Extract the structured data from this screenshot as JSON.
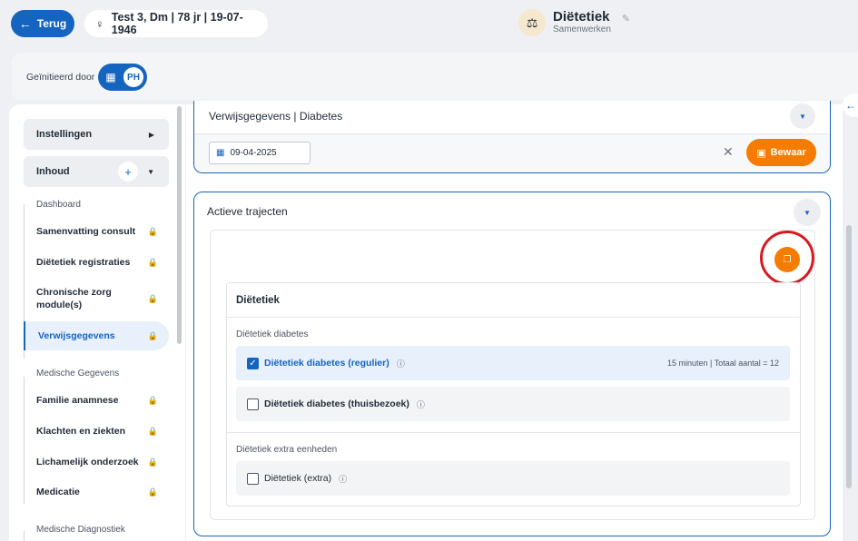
{
  "header": {
    "back_label": "Terug",
    "patient": "Test 3, Dm | 78 jr | 19-07-1946",
    "gender_icon": "female-icon",
    "module_title": "Diëtetiek",
    "module_subtitle": "Samenwerken"
  },
  "initiated": {
    "label": "Geïnitieerd door",
    "initials": "PH"
  },
  "sidebar": {
    "settings_label": "Instellingen",
    "content_label": "Inhoud",
    "plus": "+",
    "groups": {
      "dashboard": "Dashboard",
      "medical": "Medische Gegevens",
      "diagnostics": "Medische Diagnostiek"
    },
    "items": [
      {
        "label": "Samenvatting consult"
      },
      {
        "label": "Diëtetiek registraties"
      },
      {
        "label": "Chronische zorg module(s)"
      },
      {
        "label": "Verwijsgegevens",
        "active": true
      },
      {
        "label": "Familie anamnese"
      },
      {
        "label": "Klachten en ziekten"
      },
      {
        "label": "Lichamelijk onderzoek"
      },
      {
        "label": "Medicatie"
      }
    ]
  },
  "referral": {
    "title": "Verwijsgegevens | Diabetes",
    "date": "09-04-2025",
    "save_label": "Bewaar"
  },
  "trajects": {
    "title": "Actieve trajecten",
    "panel_title": "Diëtetiek",
    "section1": "Diëtetiek diabetes",
    "option1": "Diëtetiek diabetes (regulier)",
    "option1_meta": "15 minuten | Totaal aantal = 12",
    "option1_checked": true,
    "option2": "Diëtetiek diabetes (thuisbezoek)",
    "option2_checked": false,
    "section2": "Diëtetiek extra eenheden",
    "option3": "Diëtetiek (extra)",
    "option3_checked": false
  },
  "colors": {
    "primary": "#1565c0",
    "accent": "#f57c00",
    "highlight_ring": "#d71920"
  }
}
